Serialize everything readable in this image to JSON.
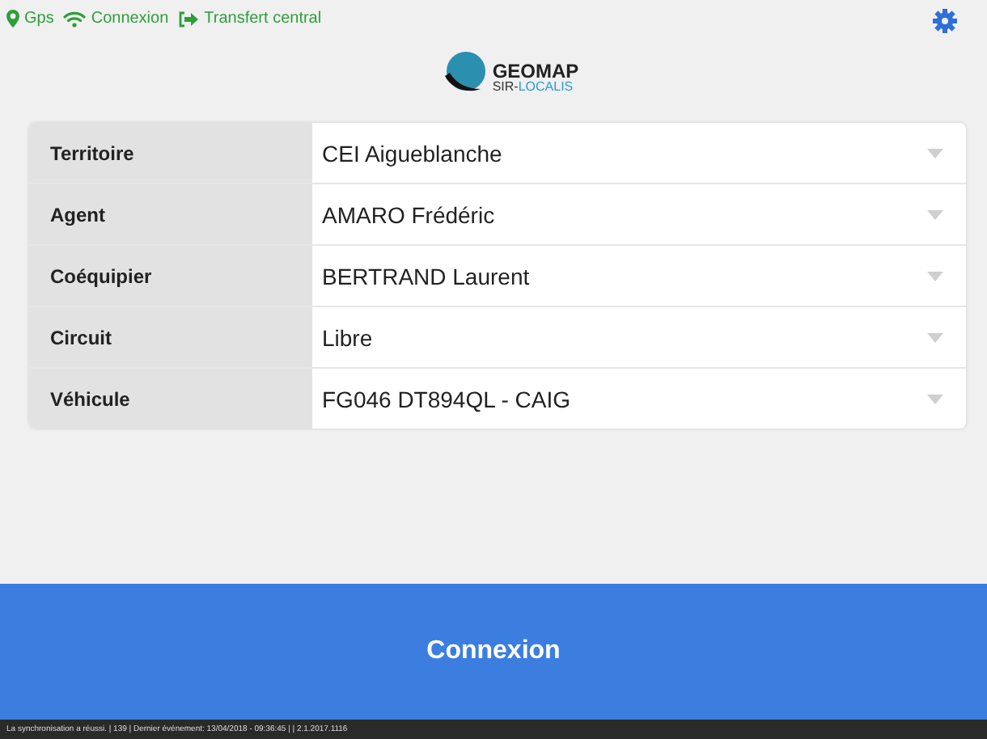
{
  "status_indicators": [
    {
      "kind": "gps",
      "label": "Gps"
    },
    {
      "kind": "wifi",
      "label": "Connexion"
    },
    {
      "kind": "transfer",
      "label": "Transfert central"
    }
  ],
  "logo": {
    "name": "GEOMAP",
    "sub_prefix": "SIR-",
    "sub_suffix": "LOCALIS"
  },
  "form_fields": [
    {
      "label": "Territoire",
      "value": "CEI Aigueblanche"
    },
    {
      "label": "Agent",
      "value": "AMARO Frédéric"
    },
    {
      "label": "Coéquipier",
      "value": "BERTRAND Laurent"
    },
    {
      "label": "Circuit",
      "value": "Libre"
    },
    {
      "label": "Véhicule",
      "value": "FG046 DT894QL - CAIG"
    }
  ],
  "connect_button": "Connexion",
  "status_bar": "La synchronisation a réussi. | 139 | Dernier événement: 13/04/2018 - 09:36:45 | | 2.1.2017.1116"
}
